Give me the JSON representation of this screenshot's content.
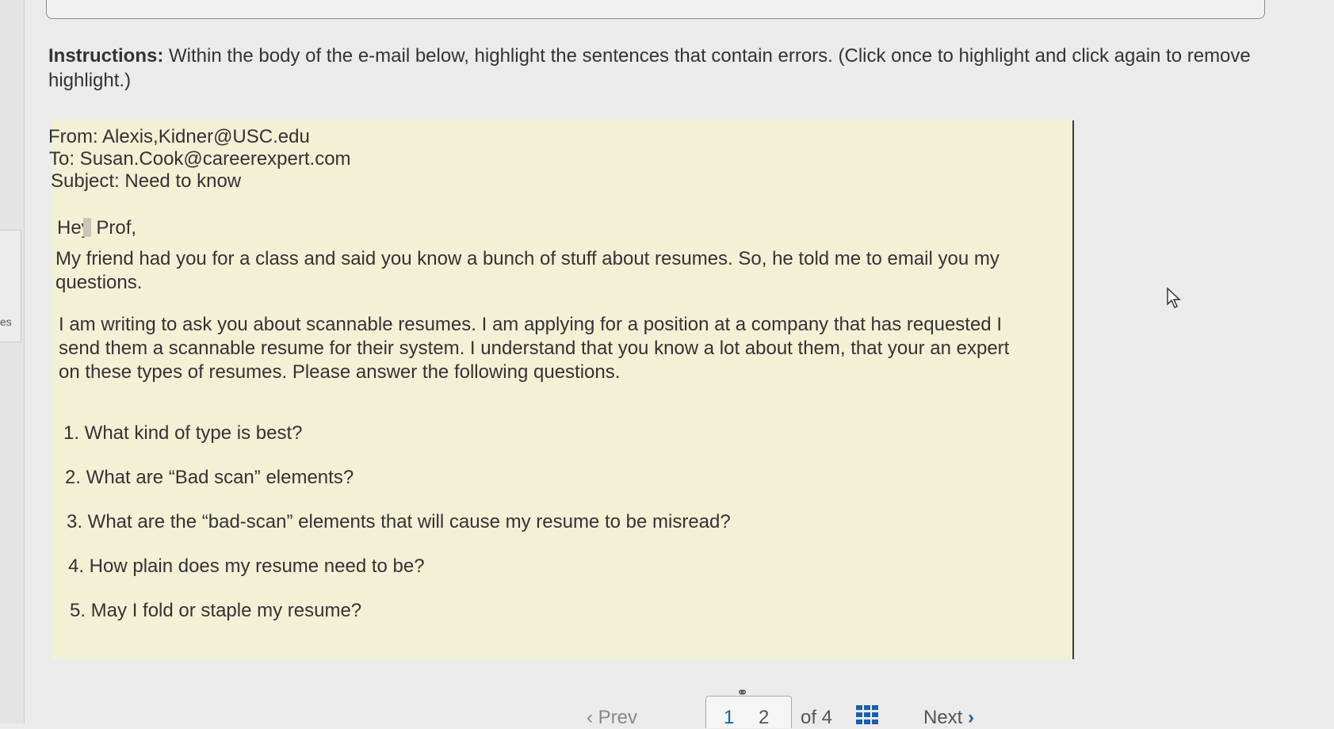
{
  "rail": {
    "text": "es"
  },
  "instructions": {
    "label": "Instructions:",
    "text": " Within the body of the e-mail below, highlight the sentences that contain errors. (Click once to highlight and click again to remove highlight.)"
  },
  "email": {
    "from": "From: Alexis,Kidner@USC.edu",
    "to": "To: Susan.Cook@careerexpert.com",
    "subject": "Subject: Need to know",
    "greeting_a": "Hey",
    "greeting_b": " Prof,",
    "para1": "My friend had you for a class and said you know a bunch of stuff about resumes. So, he told me to email you my questions.",
    "para2": "I am writing to ask you about scannable resumes. I am applying for a position at a company that has requested I send them a scannable resume for their system. I understand that you know a lot about them, that your an expert on these types of resumes. Please answer the following questions.",
    "questions": [
      "1. What kind of type is best?",
      "2. What are “Bad scan” elements?",
      "3. What are the “bad-scan” elements that will cause my resume to be misread?",
      "4. How plain does my resume need to be?",
      "5. May I fold or staple my resume?"
    ]
  },
  "pager": {
    "prev_label": "Prev",
    "prev_chevron": "‹",
    "page1": "1",
    "page2": "2",
    "of_label": "of 4",
    "next_label": "Next",
    "next_chevron": "›",
    "link_glyph": "⚭"
  },
  "colors": {
    "email_bg": "#f3f0d6",
    "accent": "#1a5fa8"
  }
}
